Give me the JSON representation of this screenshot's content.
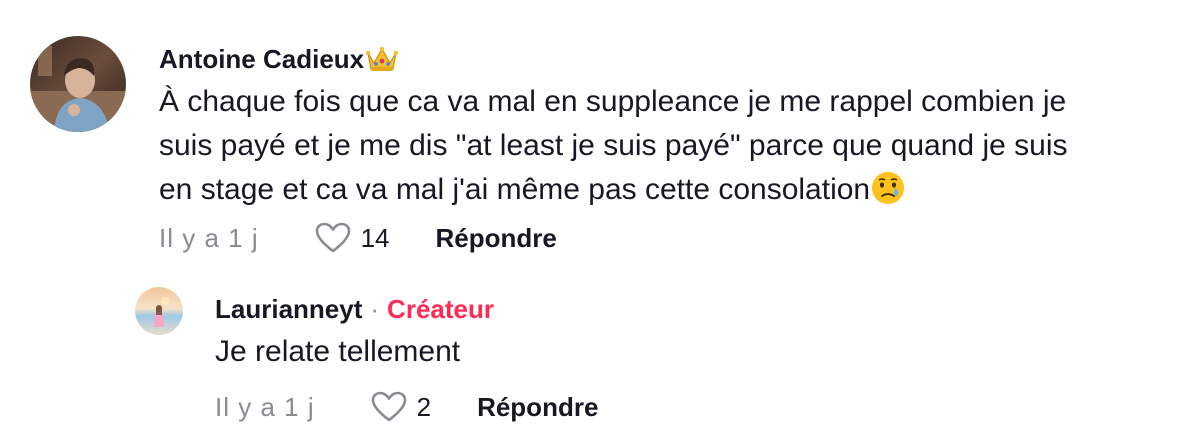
{
  "comment": {
    "author": "Antoine Cadieux",
    "author_emoji_icon": "crown-emoji",
    "text_lines": [
      "À chaque fois que ca va mal en suppleance je me rappel combien je",
      "suis payé et je me dis \"at least je suis payé\" parce que quand je suis",
      "en stage et ca va mal j'ai même pas cette consolation"
    ],
    "text_end_emoji_icon": "crying-face-emoji",
    "timestamp": "Il y a 1 j",
    "like_count": "14",
    "reply_label": "Répondre"
  },
  "reply": {
    "author": "Laurianneyt",
    "separator": "·",
    "badge": "Créateur",
    "text": "Je relate tellement",
    "timestamp": "Il y a 1 j",
    "like_count": "2",
    "reply_label": "Répondre"
  },
  "colors": {
    "text_primary": "#161823",
    "text_secondary": "#8a8b91",
    "creator_badge": "#fe2c55"
  }
}
